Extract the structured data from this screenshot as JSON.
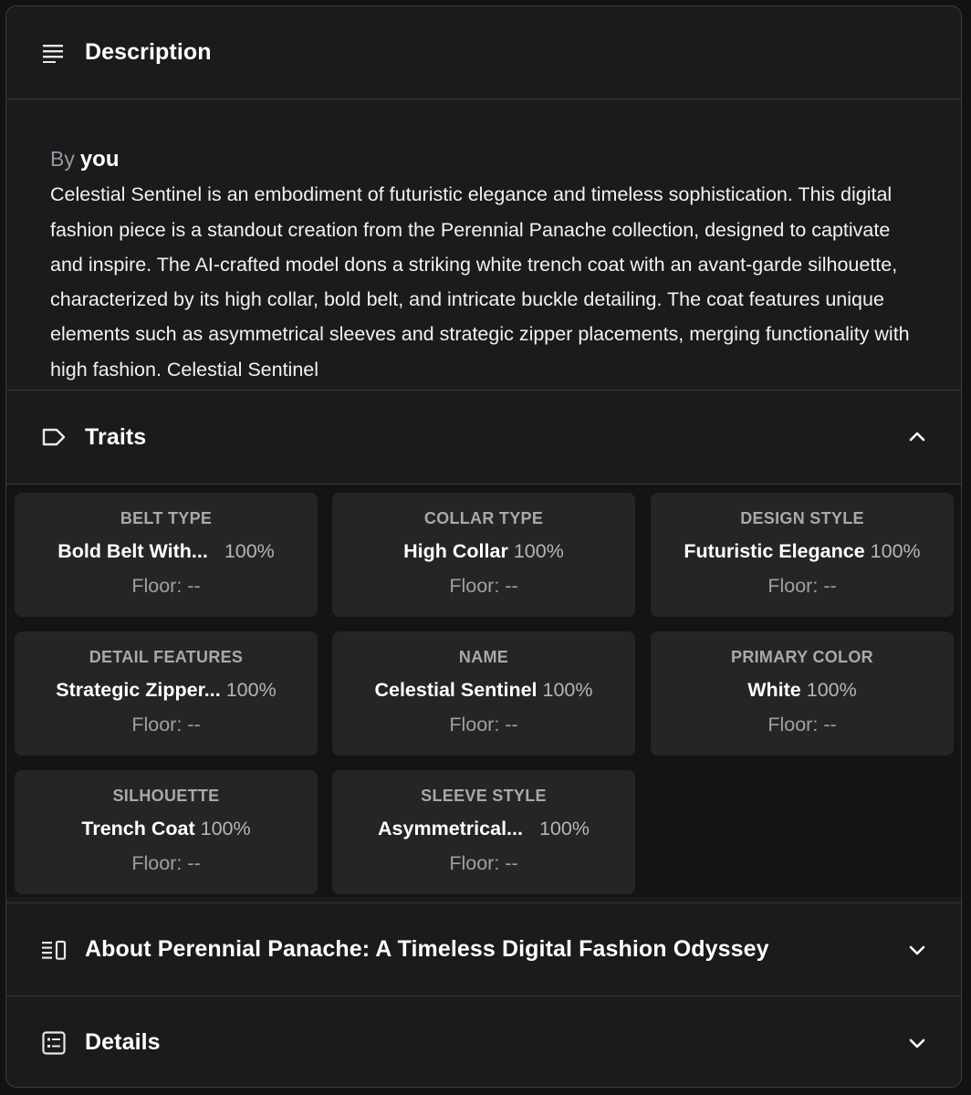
{
  "description": {
    "title": "Description",
    "by_label": "By",
    "author": "you",
    "text": "Celestial Sentinel is an embodiment of futuristic elegance and timeless sophistication. This digital fashion piece is a standout creation from the Perennial Panache collection, designed to captivate and inspire. The AI-crafted model dons a striking white trench coat with an avant-garde silhouette, characterized by its high collar, bold belt, and intricate buckle detailing. The coat features unique elements such as asymmetrical sleeves and strategic zipper placements, merging functionality with high fashion. Celestial Sentinel"
  },
  "traits": {
    "title": "Traits",
    "floor_label": "Floor:",
    "items": [
      {
        "type": "BELT TYPE",
        "value": "Bold Belt With...",
        "pct": "100%",
        "floor": "--"
      },
      {
        "type": "COLLAR TYPE",
        "value": "High Collar",
        "pct": "100%",
        "floor": "--"
      },
      {
        "type": "DESIGN STYLE",
        "value": "Futuristic Elegance",
        "pct": "100%",
        "floor": "--"
      },
      {
        "type": "DETAIL FEATURES",
        "value": "Strategic Zipper...",
        "pct": "100%",
        "floor": "--"
      },
      {
        "type": "NAME",
        "value": "Celestial Sentinel",
        "pct": "100%",
        "floor": "--"
      },
      {
        "type": "PRIMARY COLOR",
        "value": "White",
        "pct": "100%",
        "floor": "--"
      },
      {
        "type": "SILHOUETTE",
        "value": "Trench Coat",
        "pct": "100%",
        "floor": "--"
      },
      {
        "type": "SLEEVE STYLE",
        "value": "Asymmetrical...",
        "pct": "100%",
        "floor": "--"
      }
    ]
  },
  "about": {
    "title": "About Perennial Panache: A Timeless Digital Fashion Odyssey"
  },
  "details": {
    "title": "Details"
  },
  "icons": {
    "description": "text-lines-icon",
    "traits": "tag-icon",
    "about": "list-column-icon",
    "details": "list-box-icon",
    "expanded": "chevron-up-icon",
    "collapsed": "chevron-down-icon"
  },
  "colors": {
    "background": "#1b1b1b",
    "card": "#252525",
    "border": "#3a3a3a",
    "muted": "#a0a0a0",
    "by_label": "#8f99a3"
  }
}
